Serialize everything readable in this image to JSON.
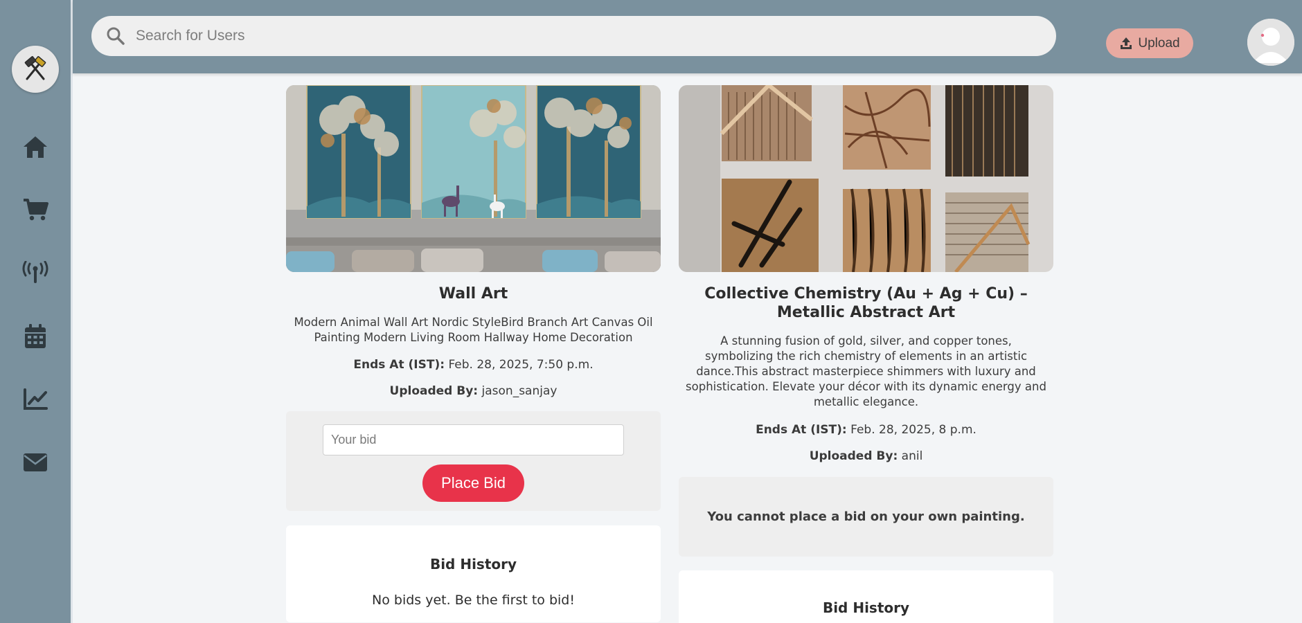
{
  "search": {
    "placeholder": "Search for Users"
  },
  "header": {
    "upload_label": "Upload"
  },
  "sidebar": {
    "items": [
      {
        "name": "home",
        "icon": "home-icon"
      },
      {
        "name": "cart",
        "icon": "cart-icon"
      },
      {
        "name": "live",
        "icon": "broadcast-icon"
      },
      {
        "name": "calendar",
        "icon": "calendar-icon"
      },
      {
        "name": "stats",
        "icon": "chart-line-icon"
      },
      {
        "name": "mail",
        "icon": "envelope-icon"
      }
    ]
  },
  "colors": {
    "header": "#7a919e",
    "upload": "#e8aaa1",
    "place_bid": "#e8334a",
    "background": "#f3f5f7"
  },
  "cards": [
    {
      "title": "Wall Art",
      "description": "Modern Animal Wall Art Nordic StyleBird Branch Art Canvas Oil Painting Modern Living Room Hallway Home Decoration",
      "ends_label": "Ends At (IST):",
      "ends_value": "Feb. 28, 2025, 7:50 p.m.",
      "uploaded_label": "Uploaded By:",
      "uploaded_value": "jason_sanjay",
      "bid_placeholder": "Your bid",
      "bid_button": "Place Bid",
      "history_title": "Bid History",
      "history_empty": "No bids yet. Be the first to bid!"
    },
    {
      "title": "Collective Chemistry (Au + Ag + Cu) – Metallic Abstract Art",
      "description": "A stunning fusion of gold, silver, and copper tones, symbolizing the rich chemistry of elements in an artistic dance.This abstract masterpiece shimmers with luxury and sophistication. Elevate your décor with its dynamic energy and metallic elegance.",
      "ends_label": "Ends At (IST):",
      "ends_value": "Feb. 28, 2025, 8 p.m.",
      "uploaded_label": "Uploaded By:",
      "uploaded_value": "anil",
      "own_message": "You cannot place a bid on your own painting.",
      "history_title": "Bid History"
    }
  ]
}
